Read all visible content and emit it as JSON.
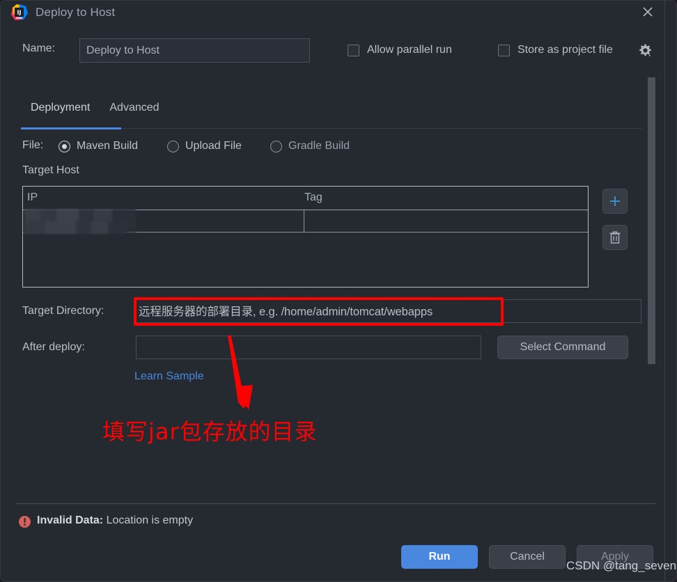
{
  "window": {
    "title": "Deploy to Host",
    "app_icon": "intellij-idea-icon",
    "close_icon": "close-icon"
  },
  "name_row": {
    "label": "Name:",
    "value": "Deploy to Host",
    "allow_parallel_run": {
      "label": "Allow parallel run",
      "checked": false
    },
    "store_as_project_file": {
      "label": "Store as project file",
      "checked": false
    },
    "gear_icon": "gear-icon"
  },
  "tabs": [
    {
      "label": "Deployment",
      "active": true
    },
    {
      "label": "Advanced",
      "active": false
    }
  ],
  "file_row": {
    "label": "File:",
    "options": [
      {
        "label": "Maven Build",
        "selected": true
      },
      {
        "label": "Upload File",
        "selected": false
      },
      {
        "label": "Gradle Build",
        "selected": false
      }
    ]
  },
  "target_host": {
    "section_label": "Target Host",
    "columns": [
      "IP",
      "Tag"
    ],
    "rows": [
      {
        "ip": "",
        "ip_redacted": true,
        "tag": ""
      }
    ],
    "add_button": {
      "icon": "plus-icon",
      "label": ""
    },
    "delete_button": {
      "icon": "trash-icon",
      "label": ""
    }
  },
  "target_directory": {
    "label": "Target Directory:",
    "value": "",
    "placeholder": "远程服务器的部署目录, e.g. /home/admin/tomcat/webapps"
  },
  "after_deploy": {
    "label": "After deploy:",
    "value": "",
    "select_command_label": "Select Command"
  },
  "learn_sample_link": "Learn Sample",
  "annotation": {
    "text": "填写jar包存放的目录",
    "color": "#fe0000",
    "arrow": "down-arrow-annotation",
    "highlight_box_color": "#fe0000"
  },
  "footer": {
    "error_icon": "error-icon",
    "error_title": "Invalid Data:",
    "error_message": "Location is empty",
    "buttons": {
      "run": "Run",
      "cancel": "Cancel",
      "apply": "Apply"
    }
  },
  "watermark": "CSDN @tang_seven",
  "colors": {
    "dialog_bg": "#252930",
    "accent_blue": "#4a88e0",
    "link_blue": "#4a88e0",
    "annotation_red": "#fe0000",
    "error_red": "#d4605c",
    "text_primary": "#bcc0c6"
  }
}
